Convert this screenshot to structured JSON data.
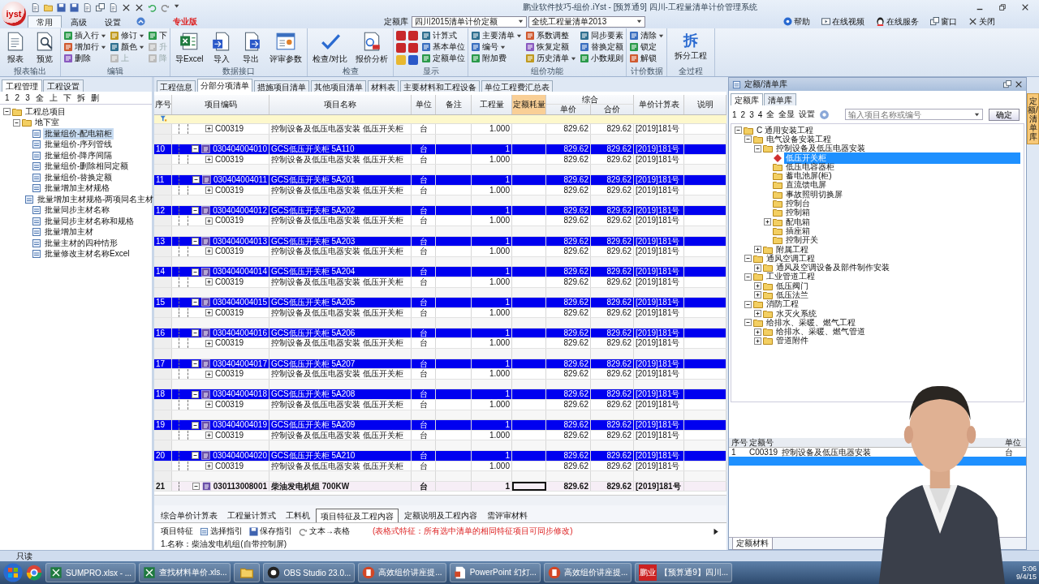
{
  "window": {
    "title": "鹏业软件技巧-组价.iYst - [预算通9] 四川-工程量清单计价管理系统"
  },
  "logo": "iyst",
  "menu_tabs": [
    {
      "label": "常用",
      "selected": true
    },
    {
      "label": "高级",
      "selected": false
    },
    {
      "label": "设置",
      "selected": false
    }
  ],
  "edition": "专业版",
  "quota_library": {
    "label": "定额库",
    "value": "四川2015清单计价定额"
  },
  "bill_library": {
    "value": "全统工程量清单2013"
  },
  "help_links": [
    "帮助",
    "在线视频",
    "在线服务",
    "窗口",
    "关闭"
  ],
  "ribbon": [
    {
      "label": "报表输出",
      "items": [
        {
          "kind": "large",
          "label": "报表"
        },
        {
          "kind": "large",
          "label": "预览"
        }
      ]
    },
    {
      "label": "编辑",
      "items": [
        {
          "kind": "menu",
          "label": "插入行",
          "disabled": false
        },
        {
          "kind": "menu",
          "label": "增加行",
          "disabled": false
        },
        {
          "kind": "small",
          "label": "删除",
          "disabled": false
        },
        {
          "kind": "menu",
          "label": "修订",
          "disabled": false
        },
        {
          "kind": "menu",
          "label": "颜色",
          "disabled": false
        },
        {
          "kind": "small",
          "label": "上",
          "disabled": true
        },
        {
          "kind": "small",
          "label": "下",
          "disabled": false
        },
        {
          "kind": "small",
          "label": "升",
          "disabled": true
        },
        {
          "kind": "small",
          "label": "降",
          "disabled": true
        }
      ]
    },
    {
      "label": "数据接口",
      "items": [
        {
          "kind": "large",
          "label": "导Excel"
        },
        {
          "kind": "large",
          "label": "导入"
        },
        {
          "kind": "large",
          "label": "导出"
        },
        {
          "kind": "large",
          "label": "评审参数"
        }
      ]
    },
    {
      "label": "检查",
      "items": [
        {
          "kind": "large",
          "label": "检查/对比"
        },
        {
          "kind": "large",
          "label": "报价分析"
        }
      ]
    },
    {
      "label": "显示",
      "items": [
        {
          "kind": "tiles"
        },
        {
          "kind": "small",
          "label": "计算式"
        },
        {
          "kind": "small",
          "label": "基本单位"
        },
        {
          "kind": "small",
          "label": "定额单位"
        }
      ]
    },
    {
      "label": "组价功能",
      "items": [
        {
          "kind": "menu",
          "label": "主要清单"
        },
        {
          "kind": "menu",
          "label": "编号"
        },
        {
          "kind": "small",
          "label": "附加费"
        },
        {
          "kind": "small",
          "label": "系数调整"
        },
        {
          "kind": "small",
          "label": "恢复定额"
        },
        {
          "kind": "menu",
          "label": "历史清单"
        },
        {
          "kind": "small",
          "label": "同步要素"
        },
        {
          "kind": "small",
          "label": "替换定额"
        },
        {
          "kind": "small",
          "label": "小数规则"
        }
      ]
    },
    {
      "label": "计价数据",
      "items": [
        {
          "kind": "menu",
          "label": "清除"
        },
        {
          "kind": "small",
          "label": "锁定"
        },
        {
          "kind": "small",
          "label": "解锁"
        }
      ]
    },
    {
      "label": "全过程",
      "items": [
        {
          "kind": "glyph",
          "glyph": "拆",
          "label": "拆分工程"
        }
      ]
    }
  ],
  "left_panel": {
    "tabs": [
      {
        "label": "工程管理",
        "selected": true
      },
      {
        "label": "工程设置",
        "selected": false
      }
    ],
    "toolbar": [
      "1",
      "2",
      "3",
      "全",
      "上",
      "下",
      "拆",
      "删"
    ],
    "tree": [
      {
        "label": "工程总项目",
        "expanded": true,
        "selected": false,
        "children": [
          {
            "label": "地下室",
            "expanded": true,
            "selected": false,
            "children": [
              {
                "label": "批量组价-配电箱柜",
                "selected": true
              },
              {
                "label": "批量组价-序列管线",
                "selected": false
              },
              {
                "label": "批量组价-降序间隔",
                "selected": false
              },
              {
                "label": "批量组价-删除相同定额",
                "selected": false
              },
              {
                "label": "批量组价-替换定额",
                "selected": false
              },
              {
                "label": "批量增加主材规格",
                "selected": false
              },
              {
                "label": "批量增加主材规格-两项同名主材",
                "selected": false
              },
              {
                "label": "批量同步主材名称",
                "selected": false
              },
              {
                "label": "批量同步主材名称和规格",
                "selected": false
              },
              {
                "label": "批量增加主材",
                "selected": false
              },
              {
                "label": "批量主材的四种情形",
                "selected": false
              },
              {
                "label": "批量修改主材名称Excel",
                "selected": false
              }
            ]
          }
        ]
      }
    ]
  },
  "doc_tabs": [
    {
      "label": "工程信息",
      "selected": false
    },
    {
      "label": "分部分项清单",
      "selected": true
    },
    {
      "label": "措施项目清单",
      "selected": false
    },
    {
      "label": "其他项目清单",
      "selected": false
    },
    {
      "label": "材料表",
      "selected": false
    },
    {
      "label": "主要材料和工程设备",
      "selected": false
    },
    {
      "label": "单位工程费汇总表",
      "selected": false
    }
  ],
  "table": {
    "columns": [
      {
        "label": "序号",
        "highlighted": false
      },
      {
        "label": "项目编码",
        "highlighted": false
      },
      {
        "label": "项目名称",
        "highlighted": false
      },
      {
        "label": "单位",
        "highlighted": false
      },
      {
        "label": "备注",
        "highlighted": false
      },
      {
        "label": "工程量",
        "highlighted": false
      },
      {
        "label": "定额耗量",
        "highlighted": true
      },
      {
        "label": "综合",
        "highlighted": false,
        "sub": [
          "单价",
          "合价"
        ]
      },
      {
        "label": "单价计算表",
        "highlighted": false
      },
      {
        "label": "说明",
        "highlighted": false
      }
    ],
    "rows": [
      {
        "kind": "quota",
        "code": "C00319",
        "name": "控制设备及低压电器安装 低压开关柜",
        "unit": "台",
        "quantity": "1.000",
        "unit_price": "829.62",
        "total": "829.62",
        "calc_table": "[2019]181号",
        "selected": false
      },
      {
        "kind": "blank",
        "selected": false
      },
      {
        "kind": "bill",
        "no": "10",
        "code": "030404004010",
        "name": "GCS低压开关柜 5A110",
        "unit": "台",
        "quantity": "1",
        "unit_price": "829.62",
        "total": "829.62",
        "calc_table": "[2019]181号",
        "selected": true,
        "expanded": true,
        "focused": false
      },
      {
        "kind": "quota",
        "code": "C00319",
        "name": "控制设备及低压电器安装 低压开关柜",
        "unit": "台",
        "quantity": "1.000",
        "unit_price": "829.62",
        "total": "829.62",
        "calc_table": "[2019]181号",
        "selected": false
      },
      {
        "kind": "blank",
        "selected": false
      },
      {
        "kind": "bill",
        "no": "11",
        "code": "030404004011",
        "name": "GCS低压开关柜 5A201",
        "unit": "台",
        "quantity": "1",
        "unit_price": "829.62",
        "total": "829.62",
        "calc_table": "[2019]181号",
        "selected": true,
        "expanded": true,
        "focused": false
      },
      {
        "kind": "quota",
        "code": "C00319",
        "name": "控制设备及低压电器安装 低压开关柜",
        "unit": "台",
        "quantity": "1.000",
        "unit_price": "829.62",
        "total": "829.62",
        "calc_table": "[2019]181号",
        "selected": false
      },
      {
        "kind": "blank",
        "selected": false
      },
      {
        "kind": "bill",
        "no": "12",
        "code": "030404004012",
        "name": "GCS低压开关柜 5A202",
        "unit": "台",
        "quantity": "1",
        "unit_price": "829.62",
        "total": "829.62",
        "calc_table": "[2019]181号",
        "selected": true,
        "expanded": true,
        "focused": false
      },
      {
        "kind": "quota",
        "code": "C00319",
        "name": "控制设备及低压电器安装 低压开关柜",
        "unit": "台",
        "quantity": "1.000",
        "unit_price": "829.62",
        "total": "829.62",
        "calc_table": "[2019]181号",
        "selected": false
      },
      {
        "kind": "blank",
        "selected": false
      },
      {
        "kind": "bill",
        "no": "13",
        "code": "030404004013",
        "name": "GCS低压开关柜 5A203",
        "unit": "台",
        "quantity": "1",
        "unit_price": "829.62",
        "total": "829.62",
        "calc_table": "[2019]181号",
        "selected": true,
        "expanded": true,
        "focused": false
      },
      {
        "kind": "quota",
        "code": "C00319",
        "name": "控制设备及低压电器安装 低压开关柜",
        "unit": "台",
        "quantity": "1.000",
        "unit_price": "829.62",
        "total": "829.62",
        "calc_table": "[2019]181号",
        "selected": false
      },
      {
        "kind": "blank",
        "selected": false
      },
      {
        "kind": "bill",
        "no": "14",
        "code": "030404004014",
        "name": "GCS低压开关柜 5A204",
        "unit": "台",
        "quantity": "1",
        "unit_price": "829.62",
        "total": "829.62",
        "calc_table": "[2019]181号",
        "selected": true,
        "expanded": true,
        "focused": false
      },
      {
        "kind": "quota",
        "code": "C00319",
        "name": "控制设备及低压电器安装 低压开关柜",
        "unit": "台",
        "quantity": "1.000",
        "unit_price": "829.62",
        "total": "829.62",
        "calc_table": "[2019]181号",
        "selected": false
      },
      {
        "kind": "blank",
        "selected": false
      },
      {
        "kind": "bill",
        "no": "15",
        "code": "030404004015",
        "name": "GCS低压开关柜 5A205",
        "unit": "台",
        "quantity": "1",
        "unit_price": "829.62",
        "total": "829.62",
        "calc_table": "[2019]181号",
        "selected": true,
        "expanded": true,
        "focused": false
      },
      {
        "kind": "quota",
        "code": "C00319",
        "name": "控制设备及低压电器安装 低压开关柜",
        "unit": "台",
        "quantity": "1.000",
        "unit_price": "829.62",
        "total": "829.62",
        "calc_table": "[2019]181号",
        "selected": false
      },
      {
        "kind": "blank",
        "selected": false
      },
      {
        "kind": "bill",
        "no": "16",
        "code": "030404004016",
        "name": "GCS低压开关柜 5A206",
        "unit": "台",
        "quantity": "1",
        "unit_price": "829.62",
        "total": "829.62",
        "calc_table": "[2019]181号",
        "selected": true,
        "expanded": true,
        "focused": false
      },
      {
        "kind": "quota",
        "code": "C00319",
        "name": "控制设备及低压电器安装 低压开关柜",
        "unit": "台",
        "quantity": "1.000",
        "unit_price": "829.62",
        "total": "829.62",
        "calc_table": "[2019]181号",
        "selected": false
      },
      {
        "kind": "blank",
        "selected": false
      },
      {
        "kind": "bill",
        "no": "17",
        "code": "030404004017",
        "name": "GCS低压开关柜 5A207",
        "unit": "台",
        "quantity": "1",
        "unit_price": "829.62",
        "total": "829.62",
        "calc_table": "[2019]181号",
        "selected": true,
        "expanded": true,
        "focused": false
      },
      {
        "kind": "quota",
        "code": "C00319",
        "name": "控制设备及低压电器安装 低压开关柜",
        "unit": "台",
        "quantity": "1.000",
        "unit_price": "829.62",
        "total": "829.62",
        "calc_table": "[2019]181号",
        "selected": false
      },
      {
        "kind": "blank",
        "selected": false
      },
      {
        "kind": "bill",
        "no": "18",
        "code": "030404004018",
        "name": "GCS低压开关柜 5A208",
        "unit": "台",
        "quantity": "1",
        "unit_price": "829.62",
        "total": "829.62",
        "calc_table": "[2019]181号",
        "selected": true,
        "expanded": true,
        "focused": false
      },
      {
        "kind": "quota",
        "code": "C00319",
        "name": "控制设备及低压电器安装 低压开关柜",
        "unit": "台",
        "quantity": "1.000",
        "unit_price": "829.62",
        "total": "829.62",
        "calc_table": "[2019]181号",
        "selected": false
      },
      {
        "kind": "blank",
        "selected": false
      },
      {
        "kind": "bill",
        "no": "19",
        "code": "030404004019",
        "name": "GCS低压开关柜 5A209",
        "unit": "台",
        "quantity": "1",
        "unit_price": "829.62",
        "total": "829.62",
        "calc_table": "[2019]181号",
        "selected": true,
        "expanded": true,
        "focused": false
      },
      {
        "kind": "quota",
        "code": "C00319",
        "name": "控制设备及低压电器安装 低压开关柜",
        "unit": "台",
        "quantity": "1.000",
        "unit_price": "829.62",
        "total": "829.62",
        "calc_table": "[2019]181号",
        "selected": false
      },
      {
        "kind": "blank",
        "selected": false
      },
      {
        "kind": "bill",
        "no": "20",
        "code": "030404004020",
        "name": "GCS低压开关柜 5A210",
        "unit": "台",
        "quantity": "1",
        "unit_price": "829.62",
        "total": "829.62",
        "calc_table": "[2019]181号",
        "selected": true,
        "expanded": true,
        "focused": false
      },
      {
        "kind": "quota",
        "code": "C00319",
        "name": "控制设备及低压电器安装 低压开关柜",
        "unit": "台",
        "quantity": "1.000",
        "unit_price": "829.62",
        "total": "829.62",
        "calc_table": "[2019]181号",
        "selected": false
      },
      {
        "kind": "blank",
        "selected": false
      },
      {
        "kind": "bill",
        "no": "21",
        "code": "030113008001",
        "name": "柴油发电机组 700KW",
        "unit": "台",
        "quantity": "1",
        "unit_price": "829.62",
        "total": "829.62",
        "calc_table": "[2019]181号",
        "selected": false,
        "expanded": true,
        "focused": true
      }
    ]
  },
  "detail": {
    "tabs": [
      {
        "label": "综合单价计算表",
        "selected": false
      },
      {
        "label": "工程量计算式",
        "selected": false
      },
      {
        "label": "工料机",
        "selected": false
      },
      {
        "label": "项目特征及工程内容",
        "selected": true
      },
      {
        "label": "定额说明及工程内容",
        "selected": false
      },
      {
        "label": "需评审材料",
        "selected": false
      }
    ],
    "toolbar": [
      "项目特征",
      "选择指引",
      "保存指引",
      "文本→表格"
    ],
    "note": "(表格式特征：所有选中清单的相同特征项目可同步修改)",
    "content": "1.名称：柴油发电机组(自带控制屏)"
  },
  "library": {
    "title": "定额/清单库",
    "tabs": [
      {
        "label": "定额库",
        "selected": true
      },
      {
        "label": "清单库",
        "selected": false
      }
    ],
    "toolbar": [
      "1",
      "2",
      "3",
      "4",
      "全",
      "全显",
      "设置"
    ],
    "search": {
      "placeholder": "输入项目名称或编号"
    },
    "confirm": "确定",
    "tree": [
      {
        "label": "C 通用安装工程",
        "expanded": true,
        "selected": false,
        "children": [
          {
            "label": "电气设备安装工程",
            "expanded": true,
            "selected": false,
            "children": [
              {
                "label": "控制设备及低压电器安装",
                "expanded": true,
                "selected": false,
                "children": [
                  {
                    "label": "低压开关柜",
                    "selected": true
                  },
                  {
                    "label": "低压电容器柜",
                    "selected": false
                  },
                  {
                    "label": "蓄电池屏(柜)",
                    "selected": false
                  },
                  {
                    "label": "直流馈电屏",
                    "selected": false
                  },
                  {
                    "label": "事故照明切换屏",
                    "selected": false
                  },
                  {
                    "label": "控制台",
                    "selected": false
                  },
                  {
                    "label": "控制箱",
                    "selected": false
                  },
                  {
                    "label": "配电箱",
                    "expanded": false,
                    "selected": false
                  },
                  {
                    "label": "插座箱",
                    "selected": false
                  },
                  {
                    "label": "控制开关",
                    "selected": false
                  }
                ]
              },
              {
                "label": "附属工程",
                "expanded": false,
                "selected": false
              }
            ]
          },
          {
            "label": "通风空调工程",
            "expanded": true,
            "selected": false,
            "children": [
              {
                "label": "通风及空调设备及部件制作安装",
                "expanded": false,
                "selected": false
              }
            ]
          },
          {
            "label": "工业管道工程",
            "expanded": true,
            "selected": false,
            "children": [
              {
                "label": "低压阀门",
                "expanded": false,
                "selected": false
              },
              {
                "label": "低压法兰",
                "expanded": false,
                "selected": false
              }
            ]
          },
          {
            "label": "消防工程",
            "expanded": true,
            "selected": false,
            "children": [
              {
                "label": "水灭火系统",
                "expanded": false,
                "selected": false
              }
            ]
          },
          {
            "label": "给排水、采暖、燃气工程",
            "expanded": true,
            "selected": false,
            "children": [
              {
                "label": "给排水、采暖、燃气管道",
                "expanded": false,
                "selected": false
              },
              {
                "label": "管道附件",
                "expanded": false,
                "selected": false
              }
            ]
          }
        ]
      }
    ],
    "quota_table": {
      "columns": [
        "序号",
        "定额号",
        "单位"
      ],
      "rows": [
        {
          "no": "1",
          "code": "C00319",
          "name": "控制设备及低压电器安装",
          "unit": "台",
          "selected": false
        },
        {
          "selected": true
        }
      ]
    },
    "bottom_tab": "定额材料",
    "side_tab": "定额/清单库"
  },
  "status_bar": "只读",
  "taskbar": {
    "items": [
      {
        "kind": "spreadsheet",
        "label": "SUMPRO.xlsx - ..."
      },
      {
        "kind": "spreadsheet",
        "label": "查找材料单价.xls..."
      },
      {
        "kind": "folder"
      },
      {
        "kind": "recorder",
        "label": "OBS Studio 23.0..."
      },
      {
        "kind": "slides",
        "label": "高效组价讲座提..."
      },
      {
        "kind": "document",
        "label": "PowerPoint 幻灯..."
      },
      {
        "kind": "slides",
        "label": "高效组价讲座提..."
      },
      {
        "kind": "app",
        "badge": "鹏业",
        "label": "【预算通9】四川..."
      }
    ],
    "clock": {
      "time": "5:06",
      "date": "9/4/15"
    }
  }
}
